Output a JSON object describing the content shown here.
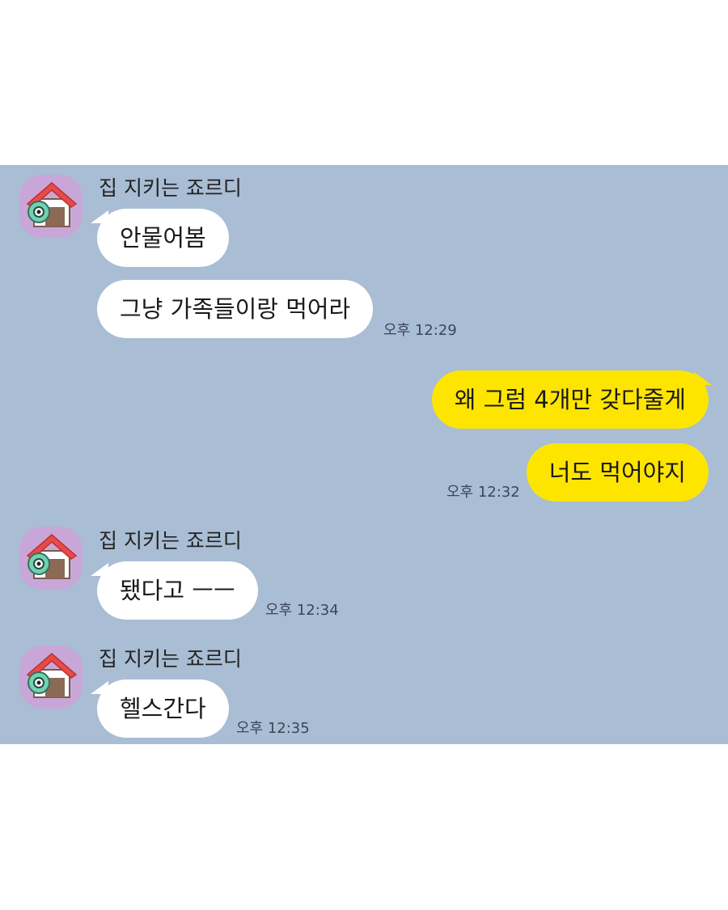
{
  "chat": {
    "background_color": "#a9bdd4",
    "incoming_bubble_color": "#ffffff",
    "outgoing_bubble_color": "#fee500",
    "groups": [
      {
        "sender": "집 지키는 죠르디",
        "avatar_icon": "house-character-icon",
        "messages": [
          "안물어봄",
          "그냥 가족들이랑 먹어라"
        ],
        "time": "오후 12:29"
      },
      {
        "outgoing": true,
        "messages": [
          "왜 그럼 4개만 갖다줄게",
          "너도 먹어야지"
        ],
        "time": "오후 12:32"
      },
      {
        "sender": "집 지키는 죠르디",
        "avatar_icon": "house-character-icon",
        "messages": [
          "됐다고 ㅡㅡ"
        ],
        "time": "오후 12:34"
      },
      {
        "sender": "집 지키는 죠르디",
        "avatar_icon": "house-character-icon",
        "messages": [
          "헬스간다"
        ],
        "time": "오후 12:35"
      }
    ]
  }
}
